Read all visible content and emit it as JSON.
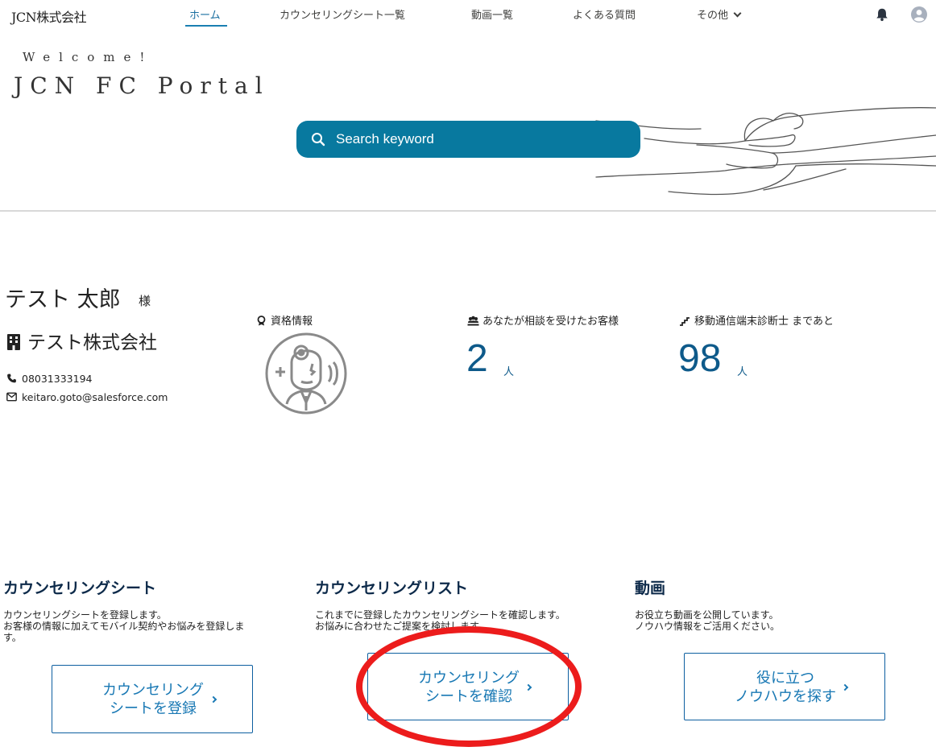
{
  "brand": "JCN株式会社",
  "nav": {
    "items": [
      {
        "label": "ホーム"
      },
      {
        "label": "カウンセリングシート一覧"
      },
      {
        "label": "動画一覧"
      },
      {
        "label": "よくある質問"
      },
      {
        "label": "その他"
      }
    ],
    "active_index": 0
  },
  "hero": {
    "welcome": "Welcome!",
    "title": "JCN FC Portal",
    "search_placeholder": "Search keyword"
  },
  "profile": {
    "name": "テスト 太郎",
    "honorific": "様",
    "company": "テスト株式会社",
    "phone": "08031333194",
    "email": "keitaro.goto@salesforce.com"
  },
  "stats": {
    "certification_label": "資格情報",
    "consulted_label": "あなたが相談を受けたお客様",
    "consulted_value": "2",
    "consulted_unit": "人",
    "remaining_label": "移動通信端末診断士 まであと",
    "remaining_value": "98",
    "remaining_unit": "人"
  },
  "cards": [
    {
      "title": "カウンセリングシート",
      "desc": [
        "カウンセリングシートを登録します。",
        "お客様の情報に加えてモバイル契約やお悩みを登録しま",
        "す。"
      ],
      "button": [
        "カウンセリング",
        "シートを登録"
      ]
    },
    {
      "title": "カウンセリングリスト",
      "desc": [
        "これまでに登録したカウンセリングシートを確認します。",
        "お悩みに合わせたご提案を検討します。"
      ],
      "button": [
        "カウンセリング",
        "シートを確認"
      ]
    },
    {
      "title": "動画",
      "desc": [
        "お役立ち動画を公開しています。",
        "ノウハウ情報をご活用ください。"
      ],
      "button": [
        "役に立つ",
        "ノウハウを探す"
      ]
    }
  ],
  "colors": {
    "accent": "#08799f",
    "stat_value": "#0e5a8a",
    "button_text": "#1878b4",
    "annotation": "#ec1c1c"
  },
  "icons": [
    "bell-icon",
    "user-avatar-icon",
    "search-icon",
    "building-icon",
    "phone-icon",
    "mail-icon",
    "award-icon",
    "people-icon",
    "stairs-icon",
    "chevron-right-icon"
  ]
}
